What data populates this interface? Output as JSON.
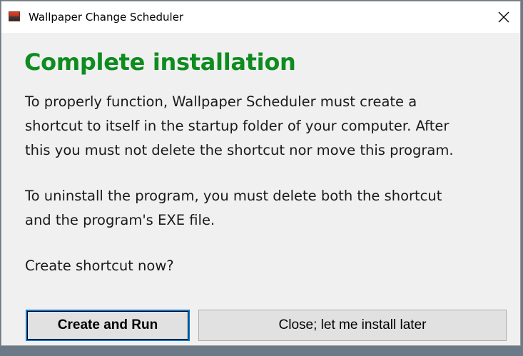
{
  "window": {
    "title": "Wallpaper Change Scheduler",
    "close_icon": "close-icon",
    "app_icon": "wallpaper-app-icon"
  },
  "dialog": {
    "heading": "Complete installation",
    "heading_color": "#0e8c1f",
    "paragraph1_lines": [
      "To properly function, Wallpaper Scheduler must create a",
      "shortcut to itself in the startup folder of your computer. After",
      "this you must not delete the shortcut nor move this program."
    ],
    "paragraph2_lines": [
      "To uninstall the program, you must delete both the shortcut",
      "and the program's EXE file."
    ],
    "question": "Create shortcut now?"
  },
  "buttons": {
    "primary_label": "Create and Run",
    "secondary_label": "Close; let me install later",
    "focus_color": "#0078d7"
  }
}
